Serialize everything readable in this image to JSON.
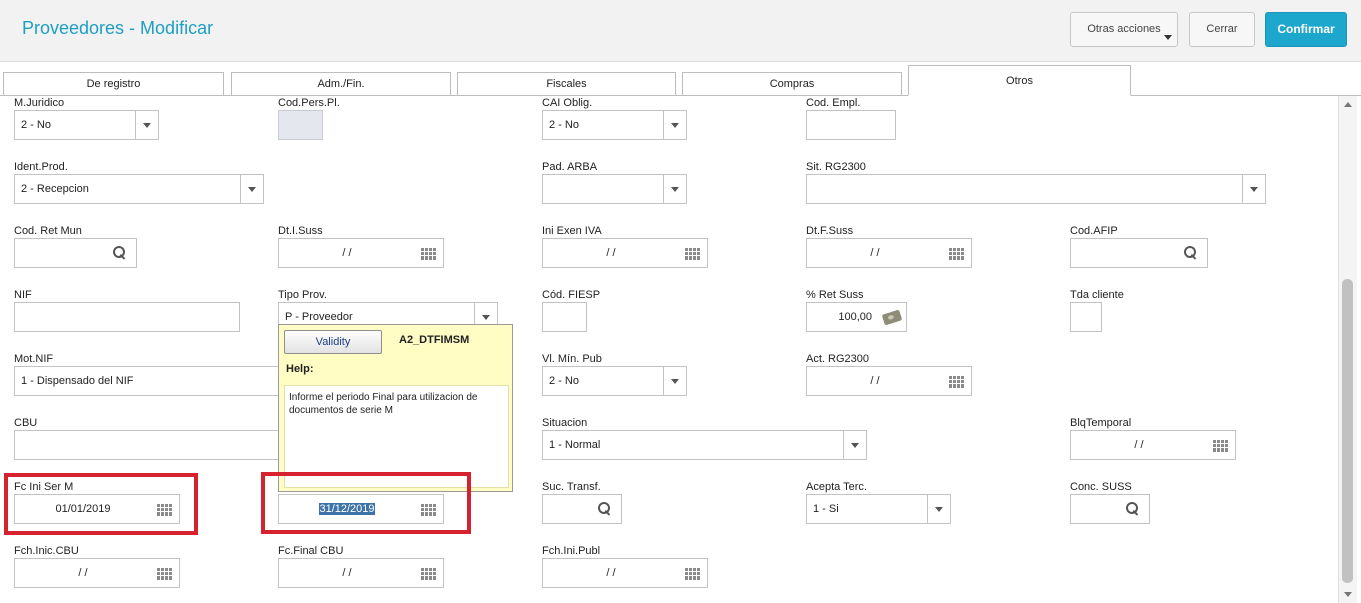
{
  "header": {
    "title": "Proveedores - Modificar",
    "buttons": {
      "other_actions": "Otras acciones",
      "close": "Cerrar",
      "confirm": "Confirmar"
    }
  },
  "tabs": [
    {
      "label": "De registro",
      "active": false
    },
    {
      "label": "Adm./Fin.",
      "active": false
    },
    {
      "label": "Fiscales",
      "active": false
    },
    {
      "label": "Compras",
      "active": false
    },
    {
      "label": "Otros",
      "active": true
    }
  ],
  "fields": {
    "m_juridico": {
      "label": "M.Juridico",
      "value": "2 - No"
    },
    "cod_pers_pl": {
      "label": "Cod.Pers.Pl.",
      "value": ""
    },
    "cai_oblig": {
      "label": "CAI Oblig.",
      "value": "2 - No"
    },
    "cod_empl": {
      "label": "Cod. Empl.",
      "value": ""
    },
    "ident_prod": {
      "label": "Ident.Prod.",
      "value": "2 - Recepcion"
    },
    "pad_arba": {
      "label": "Pad. ARBA",
      "value": ""
    },
    "sit_rg2300": {
      "label": "Sit. RG2300",
      "value": ""
    },
    "cod_ret_mun": {
      "label": "Cod. Ret Mun",
      "value": ""
    },
    "dt_i_suss": {
      "label": "Dt.I.Suss",
      "value": "/ /"
    },
    "ini_exen_iva": {
      "label": "Ini Exen IVA",
      "value": "/ /"
    },
    "dt_f_suss": {
      "label": "Dt.F.Suss",
      "value": "/ /"
    },
    "cod_afip": {
      "label": "Cod.AFIP",
      "value": ""
    },
    "nif": {
      "label": "NIF",
      "value": ""
    },
    "tipo_prov": {
      "label": "Tipo Prov.",
      "value": "P - Proveedor"
    },
    "cod_fiesp": {
      "label": "Cód. FIESP",
      "value": ""
    },
    "ret_suss": {
      "label": "% Ret Suss",
      "value": "100,00"
    },
    "tda_cliente": {
      "label": "Tda cliente",
      "value": ""
    },
    "mot_nif": {
      "label": "Mot.NIF",
      "value": "1 - Dispensado del NIF"
    },
    "vl_min_pub": {
      "label": "Vl. Mín. Pub",
      "value": "2 - No"
    },
    "act_rg2300": {
      "label": "Act. RG2300",
      "value": "/ /"
    },
    "cbu": {
      "label": "CBU",
      "value": ""
    },
    "situacion": {
      "label": "Situacion",
      "value": "1 - Normal"
    },
    "blq_temporal": {
      "label": "BlqTemporal",
      "value": "/ /"
    },
    "fc_ini_ser_m": {
      "label": "Fc Ini Ser M",
      "value": "01/01/2019"
    },
    "fc_fin_ser_m": {
      "value": "31/12/2019"
    },
    "suc_transf": {
      "label": "Suc. Transf.",
      "value": ""
    },
    "acepta_terc": {
      "label": "Acepta Terc.",
      "value": "1 - Si"
    },
    "conc_suss": {
      "label": "Conc. SUSS",
      "value": ""
    },
    "fch_inic_cbu": {
      "label": "Fch.Inic.CBU",
      "value": "/ /"
    },
    "fc_final_cbu": {
      "label": "Fc.Final CBU",
      "value": "/ /"
    },
    "fch_ini_publ": {
      "label": "Fch.Ini.Publ",
      "value": "/ /"
    }
  },
  "help_popup": {
    "validity_label": "Validity",
    "field_name": "A2_DTFIMSM",
    "help_label": "Help:",
    "text": "Informe el periodo Final para utilizacion de documentos de serie M"
  },
  "colors": {
    "accent": "#1ea7cd",
    "title": "#1e9fc1",
    "highlight": "#d6212f",
    "help_bg": "#fffcc4"
  }
}
